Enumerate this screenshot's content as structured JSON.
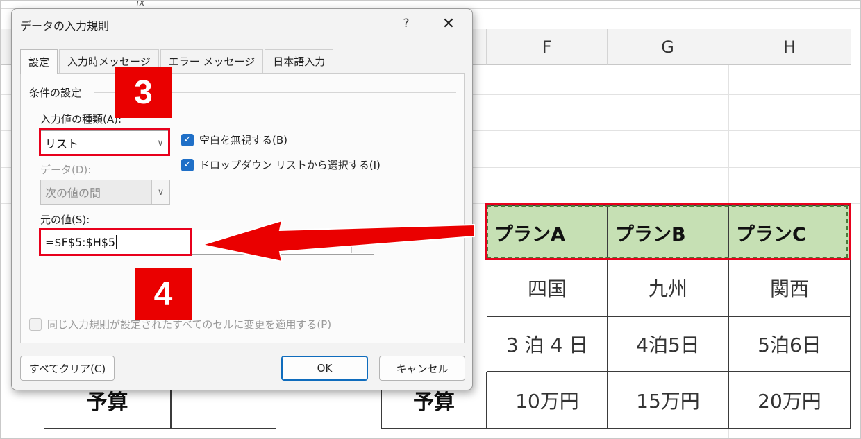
{
  "sheet": {
    "fx_symbol": "fx",
    "columns": [
      "F",
      "G",
      "H"
    ],
    "plans": [
      "プランA",
      "プランB",
      "プランC"
    ],
    "regions": [
      "四国",
      "九州",
      "関西"
    ],
    "durations": [
      "3 泊 4 日",
      "4泊5日",
      "5泊6日"
    ],
    "budgets": [
      "10万円",
      "15万円",
      "20万円"
    ],
    "budget_label_left": "予算",
    "budget_label_right": "予算"
  },
  "dialog": {
    "title": "データの入力規則",
    "help_label": "?",
    "close_label": "✕",
    "tabs": [
      "設定",
      "入力時メッセージ",
      "エラー メッセージ",
      "日本語入力"
    ],
    "active_tab": "設定",
    "group_label": "条件の設定",
    "allow_label": "入力値の種類(A):",
    "allow_value": "リスト",
    "data_label": "データ(D):",
    "data_value": "次の値の間",
    "ignore_blank": {
      "label": "空白を無視する(B)",
      "checked": true
    },
    "in_cell_dropdown": {
      "label": "ドロップダウン リストから選択する(I)",
      "checked": true
    },
    "source_label": "元の値(S):",
    "source_value": "=$F$5:$H$5",
    "apply_all": {
      "label": "同じ入力規則が設定されたすべてのセルに変更を適用する(P)",
      "checked": false
    },
    "buttons": {
      "clear_all": "すべてクリア(C)",
      "ok": "OK",
      "cancel": "キャンセル"
    }
  },
  "annotations": {
    "step3": "3",
    "step4": "4",
    "accent_color": "#ea0000"
  },
  "colors": {
    "plan_fill": "#c6e0b4",
    "checkbox_blue": "#1f6fc7"
  }
}
